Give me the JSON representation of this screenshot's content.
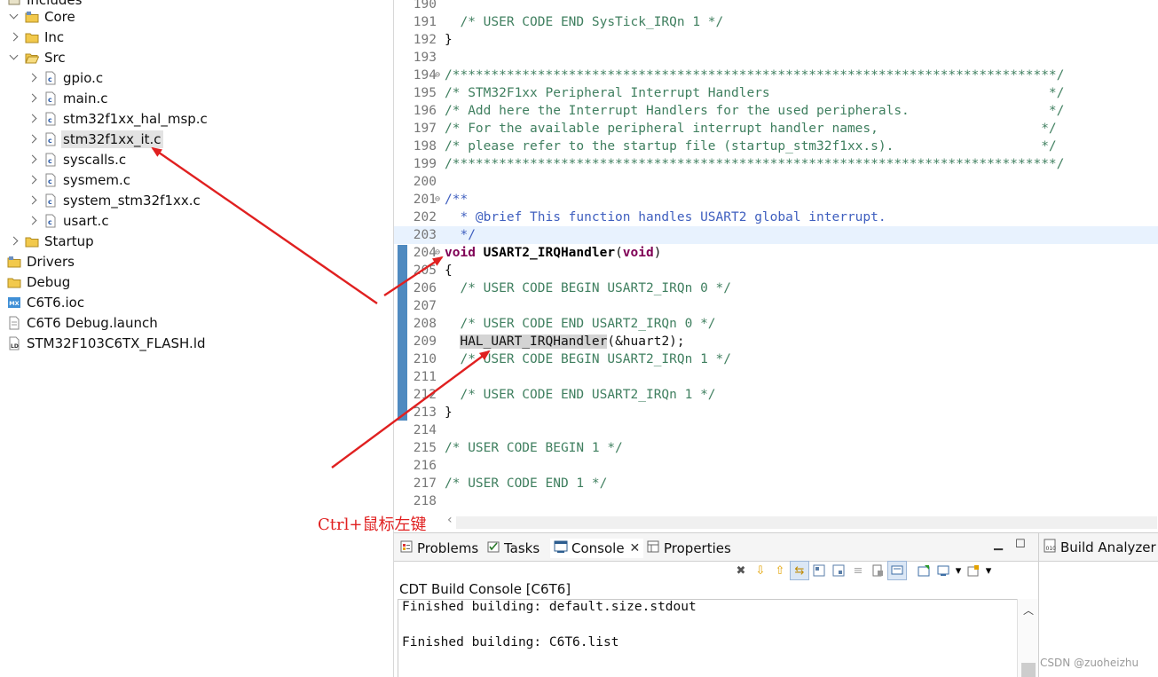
{
  "tree": {
    "items": [
      {
        "label": "Includes",
        "icon": "includes-icon",
        "chevron": "none"
      },
      {
        "label": "Core",
        "icon": "source-folder-icon",
        "chevron": "down"
      },
      {
        "label": "Inc",
        "icon": "folder-icon",
        "chevron": "right"
      },
      {
        "label": "Src",
        "icon": "folder-open-icon",
        "chevron": "down"
      },
      {
        "label": "gpio.c",
        "icon": "c-file-icon",
        "chevron": "right"
      },
      {
        "label": "main.c",
        "icon": "c-file-icon",
        "chevron": "right"
      },
      {
        "label": "stm32f1xx_hal_msp.c",
        "icon": "c-file-icon",
        "chevron": "right"
      },
      {
        "label": "stm32f1xx_it.c",
        "icon": "c-file-icon",
        "chevron": "right",
        "selected": true
      },
      {
        "label": "syscalls.c",
        "icon": "c-file-icon",
        "chevron": "right"
      },
      {
        "label": "sysmem.c",
        "icon": "c-file-icon",
        "chevron": "right"
      },
      {
        "label": "system_stm32f1xx.c",
        "icon": "c-file-icon",
        "chevron": "right"
      },
      {
        "label": "usart.c",
        "icon": "c-file-icon",
        "chevron": "right"
      },
      {
        "label": "Startup",
        "icon": "folder-icon",
        "chevron": "right"
      },
      {
        "label": "Drivers",
        "icon": "source-folder-icon",
        "chevron": "none"
      },
      {
        "label": "Debug",
        "icon": "folder-icon",
        "chevron": "none"
      },
      {
        "label": "C6T6.ioc",
        "icon": "mx-file-icon",
        "chevron": "none"
      },
      {
        "label": "C6T6 Debug.launch",
        "icon": "launch-file-icon",
        "chevron": "none"
      },
      {
        "label": "STM32F103C6TX_FLASH.ld",
        "icon": "ld-file-icon",
        "chevron": "none"
      }
    ]
  },
  "editor": {
    "lines": [
      {
        "n": "190",
        "text": ""
      },
      {
        "n": "191",
        "text": "  /* USER CODE END SysTick_IRQn 1 */"
      },
      {
        "n": "192",
        "text": "}"
      },
      {
        "n": "193",
        "text": ""
      },
      {
        "n": "194",
        "text": "/******************************************************************************/"
      },
      {
        "n": "195",
        "text": "/* STM32F1xx Peripheral Interrupt Handlers                                    */"
      },
      {
        "n": "196",
        "text": "/* Add here the Interrupt Handlers for the used peripherals.                  */"
      },
      {
        "n": "197",
        "text": "/* For the available peripheral interrupt handler names,                     */"
      },
      {
        "n": "198",
        "text": "/* please refer to the startup file (startup_stm32f1xx.s).                   */"
      },
      {
        "n": "199",
        "text": "/******************************************************************************/"
      },
      {
        "n": "200",
        "text": ""
      },
      {
        "n": "201",
        "text": "/**"
      },
      {
        "n": "202",
        "text": "  * @brief This function handles USART2 global interrupt."
      },
      {
        "n": "203",
        "text": "  */"
      },
      {
        "n": "204",
        "kw": "void",
        "fn": "USART2_IRQHandler",
        "rest": "(",
        "kw2": "void",
        "rest2": ")"
      },
      {
        "n": "205",
        "text": "{"
      },
      {
        "n": "206",
        "text": "  /* USER CODE BEGIN USART2_IRQn 0 */"
      },
      {
        "n": "207",
        "text": ""
      },
      {
        "n": "208",
        "text": "  /* USER CODE END USART2_IRQn 0 */"
      },
      {
        "n": "209",
        "hl": "HAL_UART_IRQHandler",
        "rest": "(&huart2);"
      },
      {
        "n": "210",
        "text": "  /* USER CODE BEGIN USART2_IRQn 1 */"
      },
      {
        "n": "211",
        "text": ""
      },
      {
        "n": "212",
        "text": "  /* USER CODE END USART2_IRQn 1 */"
      },
      {
        "n": "213",
        "text": "}"
      },
      {
        "n": "214",
        "text": ""
      },
      {
        "n": "215",
        "text": "/* USER CODE BEGIN 1 */"
      },
      {
        "n": "216",
        "text": ""
      },
      {
        "n": "217",
        "text": "/* USER CODE END 1 */"
      },
      {
        "n": "218",
        "text": ""
      }
    ]
  },
  "bottom": {
    "tabs": {
      "problems": "Problems",
      "tasks": "Tasks",
      "console": "Console",
      "properties": "Properties"
    },
    "console_title": "CDT Build Console [C6T6]",
    "console_lines": [
      "Finished building: default.size.stdout",
      "",
      "Finished building: C6T6.list"
    ]
  },
  "right_panel": {
    "tab": "Build Analyzer"
  },
  "annotation": {
    "text": "Ctrl+鼠标左键",
    "color": "#e02020"
  },
  "watermark": "CSDN @zuoheizhu"
}
